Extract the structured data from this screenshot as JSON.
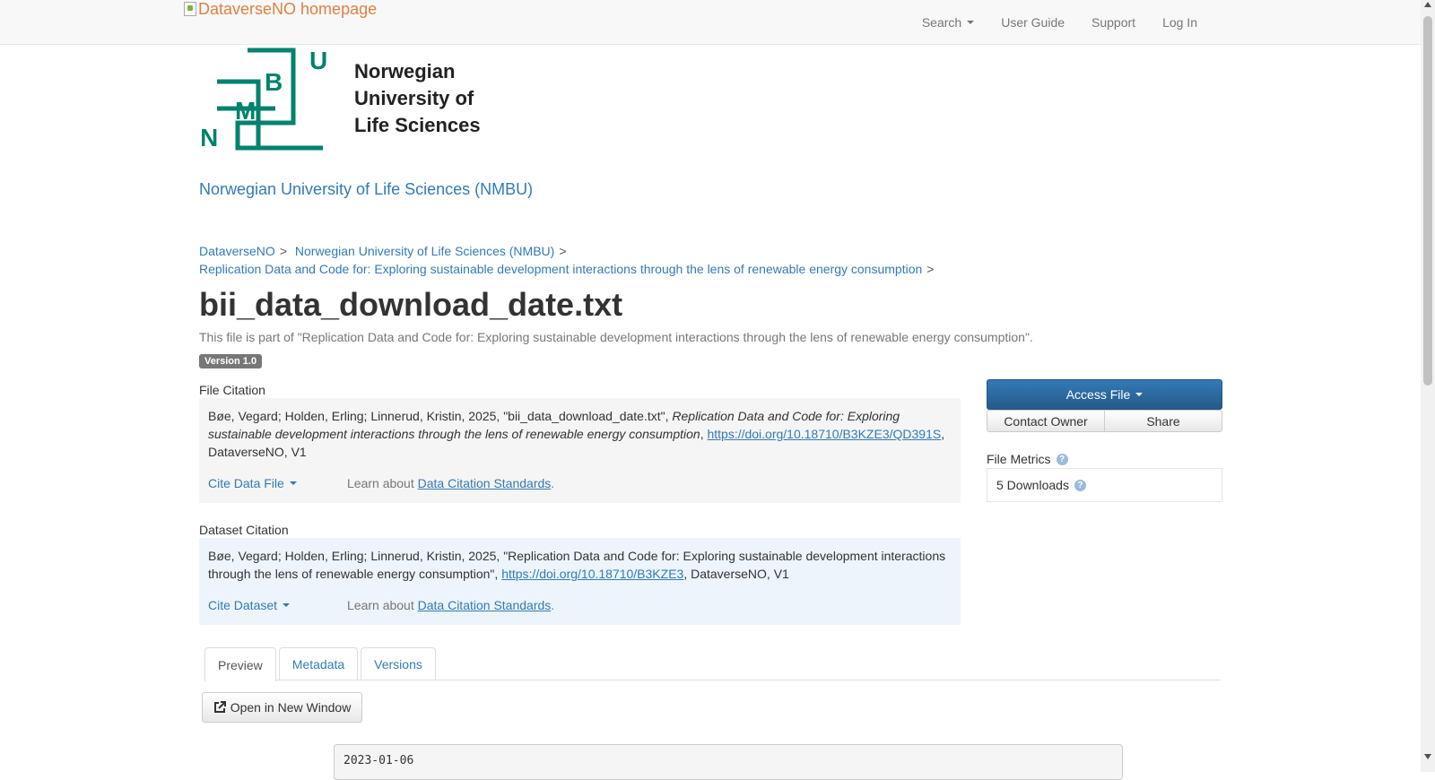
{
  "navbar": {
    "brand_alt": "DataverseNO homepage",
    "items": [
      {
        "label": "Search",
        "has_caret": true
      },
      {
        "label": "User Guide"
      },
      {
        "label": "Support"
      },
      {
        "label": "Log In"
      }
    ]
  },
  "logo": {
    "letters": [
      "U",
      "B",
      "M",
      "N"
    ],
    "text_lines": [
      "Norwegian",
      "University of",
      "Life Sciences"
    ],
    "color": "#00826e"
  },
  "dataverse_title": "Norwegian University of Life Sciences (NMBU)",
  "breadcrumb": [
    "DataverseNO",
    "Norwegian University of Life Sciences (NMBU)",
    "Replication Data and Code for: Exploring sustainable development interactions through the lens of renewable energy consumption"
  ],
  "breadcrumb_separator": ">",
  "file": {
    "title": "bii_data_download_date.txt",
    "subtitle": "This file is part of \"Replication Data and Code for: Exploring sustainable development interactions through the lens of renewable energy consumption\".",
    "version": "Version 1.0"
  },
  "file_citation": {
    "label": "File Citation",
    "text_prefix": "Bøe, Vegard; Holden, Erling; Linnerud, Kristin, 2025, \"bii_data_download_date.txt\", ",
    "text_italic": "Replication Data and Code for: Exploring sustainable development interactions through the lens of renewable energy consumption",
    "text_sep": ", ",
    "doi": "https://doi.org/10.18710/B3KZE3/QD391S",
    "text_suffix": ", DataverseNO, V1",
    "cite_button": "Cite Data File",
    "learn_prefix": "Learn about ",
    "learn_link": "Data Citation Standards",
    "learn_suffix": ".",
    "bg": "#f5f5f5"
  },
  "dataset_citation": {
    "label": "Dataset Citation",
    "text_prefix": "Bøe, Vegard; Holden, Erling; Linnerud, Kristin, 2025, \"Replication Data and Code for: Exploring sustainable development interactions through the lens of renewable energy consumption\", ",
    "doi": "https://doi.org/10.18710/B3KZE3",
    "text_suffix": ", DataverseNO, V1",
    "cite_button": "Cite Dataset",
    "learn_prefix": "Learn about ",
    "learn_link": "Data Citation Standards",
    "learn_suffix": ".",
    "bg": "#edf4fb"
  },
  "actions": {
    "access_file": "Access File",
    "contact_owner": "Contact Owner",
    "share": "Share"
  },
  "metrics": {
    "label": "File Metrics",
    "downloads": "5 Downloads",
    "help_glyph": "?"
  },
  "tabs": [
    {
      "label": "Preview",
      "active": true
    },
    {
      "label": "Metadata",
      "active": false
    },
    {
      "label": "Versions",
      "active": false
    }
  ],
  "preview": {
    "open_button": "Open in New Window",
    "content": "2023-01-06"
  },
  "colors": {
    "link": "#337ab7",
    "primary_button": "#2e6da4",
    "logo_green": "#00826e"
  }
}
